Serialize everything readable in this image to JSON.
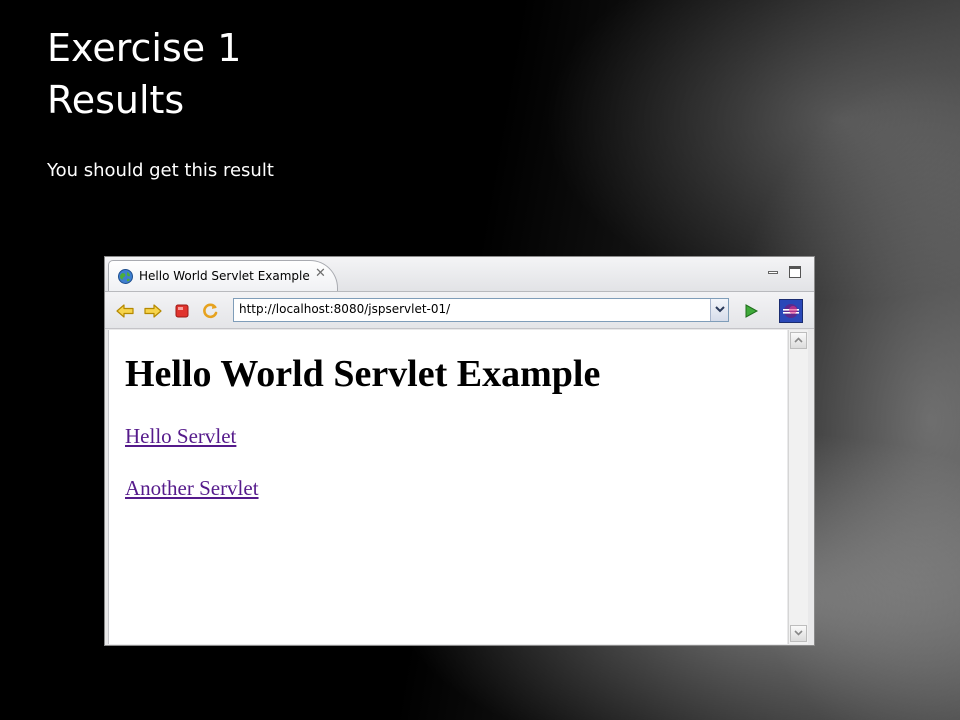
{
  "slide": {
    "title_line1": "Exercise 1",
    "title_line2": "Results",
    "subtitle": "You should get this result"
  },
  "browser": {
    "tab_title": "Hello World Servlet Example",
    "tab_close": "✕",
    "url": "http://localhost:8080/jspservlet-01/",
    "toolbar_icons": [
      "back-arrow-icon",
      "forward-arrow-icon",
      "stop-icon",
      "refresh-icon",
      "go-icon",
      "eclipse-icon"
    ]
  },
  "page": {
    "heading": "Hello World Servlet Example",
    "links": [
      "Hello Servlet",
      "Another Servlet"
    ],
    "link_color": "#551a8b"
  }
}
